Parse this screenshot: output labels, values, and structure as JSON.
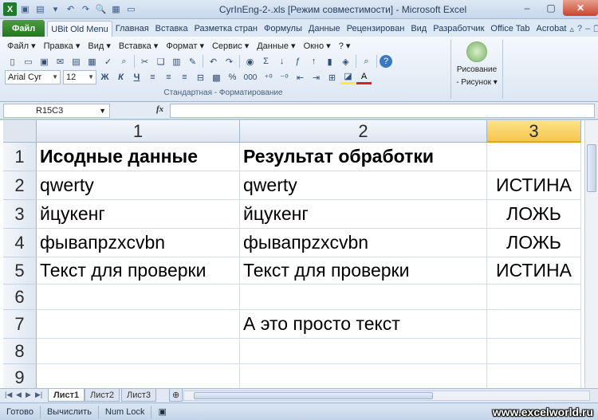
{
  "window": {
    "title": "CyrInEng-2-.xls [Режим совместимости] - Microsoft Excel"
  },
  "ribbon_tabs": [
    "Файл",
    "UBit Old Menu",
    "Главная",
    "Вставка",
    "Разметка стран",
    "Формулы",
    "Данные",
    "Рецензирован",
    "Вид",
    "Разработчик",
    "Office Tab",
    "Acrobat"
  ],
  "menu": [
    "Файл ▾",
    "Правка ▾",
    "Вид ▾",
    "Вставка ▾",
    "Формат ▾",
    "Сервис ▾",
    "Данные ▾",
    "Окно ▾",
    "? ▾"
  ],
  "toolbar": {
    "font_name": "Arial Cyr",
    "font_size": "12",
    "bold": "Ж",
    "italic": "К",
    "underline": "Ч",
    "percent": "%",
    "thousands": "000",
    "group_label": "Стандартная - Форматирование",
    "drawing_label_1": "Рисование",
    "drawing_label_2": "- Рисунок ▾"
  },
  "formula_bar": {
    "name_box": "R15C3",
    "fx": "fx",
    "formula": ""
  },
  "columns": [
    {
      "label": "1",
      "selected": false
    },
    {
      "label": "2",
      "selected": false
    },
    {
      "label": "3",
      "selected": true
    }
  ],
  "rows": [
    {
      "num": "1",
      "cells": [
        "Исодные данные",
        "Результат обработки",
        ""
      ],
      "bold": true
    },
    {
      "num": "2",
      "cells": [
        "qwerty",
        "qwerty",
        "ИСТИНА"
      ],
      "bold": false
    },
    {
      "num": "3",
      "cells": [
        "йцукенг",
        "йцукенг",
        "ЛОЖЬ"
      ],
      "bold": false
    },
    {
      "num": "4",
      "cells": [
        "фывапрzxcvbn",
        "фывапрzxcvbn",
        "ЛОЖЬ"
      ],
      "bold": false
    },
    {
      "num": "5",
      "cells": [
        "Текст для проверки",
        "Текст для проверки",
        "ИСТИНА"
      ],
      "bold": false
    },
    {
      "num": "6",
      "cells": [
        "",
        "",
        ""
      ],
      "bold": false
    },
    {
      "num": "7",
      "cells": [
        "",
        "А это просто текст",
        ""
      ],
      "bold": false
    },
    {
      "num": "8",
      "cells": [
        "",
        "",
        ""
      ],
      "bold": false
    },
    {
      "num": "9",
      "cells": [
        "",
        "",
        ""
      ],
      "bold": false
    }
  ],
  "sheets": [
    {
      "label": "Лист1",
      "active": true
    },
    {
      "label": "Лист2",
      "active": false
    },
    {
      "label": "Лист3",
      "active": false
    }
  ],
  "status": {
    "ready": "Готово",
    "calculate": "Вычислить",
    "num_lock": "Num Lock",
    "watermark": "www.excelworld.ru"
  },
  "colors": {
    "file_tab": "#24761e",
    "selected_column": "#f6c64d",
    "ribbon_bg": "#dce7f4"
  }
}
